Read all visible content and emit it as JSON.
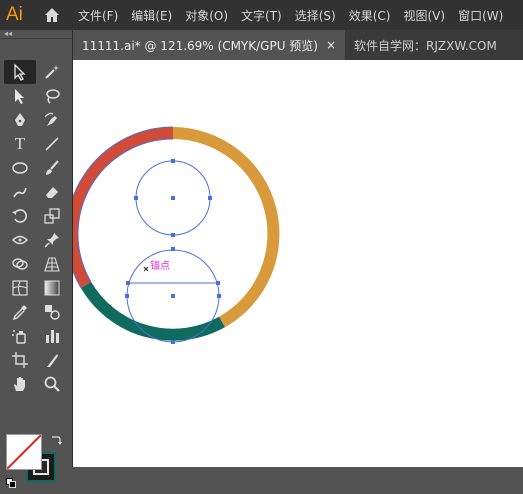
{
  "app": {
    "logo": "Ai"
  },
  "menu": [
    "文件(F)",
    "编辑(E)",
    "对象(O)",
    "文字(T)",
    "选择(S)",
    "效果(C)",
    "视图(V)",
    "窗口(W)"
  ],
  "tabs": [
    {
      "label": "11111.ai* @ 121.69% (CMYK/GPU 预览)",
      "close": "×"
    },
    {
      "label": "软件自学网：RJZXW.COM"
    }
  ],
  "toolbar": {
    "collapse": "◂◂",
    "type_tool": "T"
  },
  "canvas": {
    "smart_guide_label": "锚点",
    "colors": {
      "red_segment": "#d14b36",
      "orange_segment": "#d89a3a",
      "teal_segment": "#0e6b5e",
      "selection": "#4a6fd8",
      "smart_guide": "#e030d0"
    }
  },
  "swatches": {
    "stroke_color": "#0f6b5c",
    "fill_color": "#ffffff"
  }
}
